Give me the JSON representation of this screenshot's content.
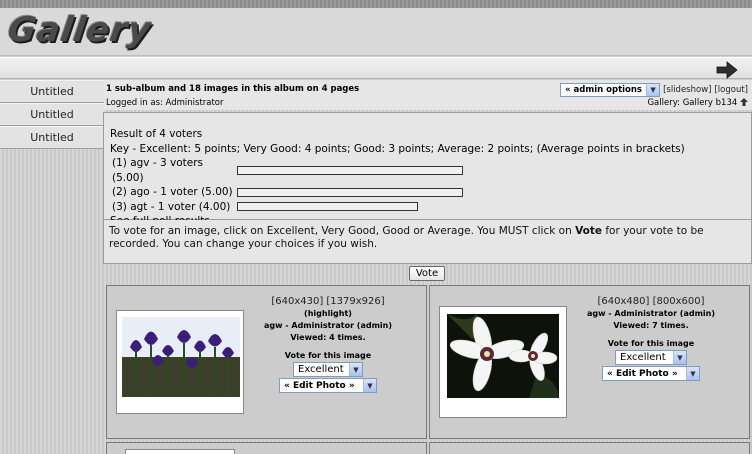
{
  "header": {
    "logo_text": "Gallery"
  },
  "sidebar": {
    "items": [
      {
        "label": "Untitled"
      },
      {
        "label": "Untitled"
      },
      {
        "label": "Untitled"
      }
    ]
  },
  "infobar": {
    "summary": "1 sub-album and 18 images in this album on 4 pages",
    "logged_in": "Logged in as: Administrator",
    "admin_options": "« admin options »",
    "slideshow": "[slideshow]",
    "logout": "[logout]",
    "gallery_version": "Gallery: Gallery b134"
  },
  "poll": {
    "result_title": "Result of 4 voters",
    "key": "Key - Excellent: 5 points; Very Good: 4 points; Good: 3 points; Average: 2 points; (Average points in brackets)",
    "results": [
      {
        "label": "(1) agv - 3 voters (5.00)",
        "fraction": 1.0
      },
      {
        "label": "(2) ago - 1 voter (5.00)",
        "fraction": 1.0
      },
      {
        "label": "(3) agt - 1 voter (4.00)",
        "fraction": 0.8
      }
    ],
    "full_results_link": "See full poll results"
  },
  "instructions": {
    "part1": "To vote for an image, click on Excellent, Very Good, Good or Average. You MUST click on ",
    "vote_word": "Vote",
    "part2": " for your vote to be recorded. You can change your choices if you wish."
  },
  "vote_button": "Vote",
  "photos": [
    {
      "sizes": "[640x430] [1379x926]",
      "highlight": "(highlight)",
      "owner": "agw - Administrator (admin)",
      "viewed": "Viewed: 4 times.",
      "vote_label": "Vote for this image",
      "vote_value": "Excellent",
      "edit_photo": "« Edit Photo »",
      "icon": "purple-iris-flowers"
    },
    {
      "sizes": "[640x480] [800x600]",
      "owner": "agw - Administrator (admin)",
      "viewed": "Viewed: 7 times.",
      "vote_label": "Vote for this image",
      "vote_value": "Excellent",
      "edit_photo": "« Edit Photo »",
      "icon": "white-clematis-flower"
    }
  ]
}
